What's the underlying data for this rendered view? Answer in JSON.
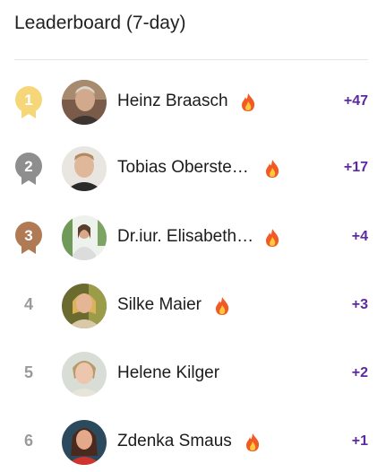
{
  "leaderboard": {
    "title": "Leaderboard (7-day)",
    "entries": [
      {
        "rank": "1",
        "medal": "gold",
        "name": "Heinz Braasch",
        "streak_icon": "flame-icon",
        "points": "+47"
      },
      {
        "rank": "2",
        "medal": "silver",
        "name": "Tobias Oberste…",
        "streak_icon": "flame-icon",
        "points": "+17"
      },
      {
        "rank": "3",
        "medal": "bronze",
        "name": "Dr.iur. Elisabeth…",
        "streak_icon": "flame-icon",
        "points": "+4"
      },
      {
        "rank": "4",
        "medal": "",
        "name": "Silke Maier",
        "streak_icon": "flame-icon",
        "points": "+3"
      },
      {
        "rank": "5",
        "medal": "",
        "name": "Helene Kilger",
        "streak_icon": "",
        "points": "+2"
      },
      {
        "rank": "6",
        "medal": "",
        "name": "Zdenka Smaus",
        "streak_icon": "flame-icon",
        "points": "+1"
      }
    ]
  },
  "colors": {
    "gold": "#f5d77a",
    "silver": "#8e8e8e",
    "bronze": "#b07a55",
    "points": "#5b2aa0"
  }
}
